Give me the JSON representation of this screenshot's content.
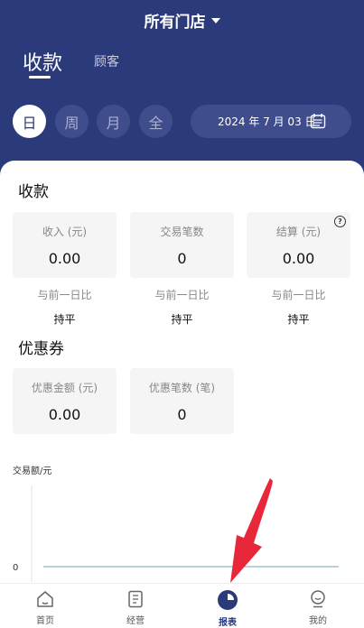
{
  "header": {
    "store_selector": "所有门店"
  },
  "tabs": [
    {
      "label": "收款",
      "active": true
    },
    {
      "label": "顾客",
      "active": false
    }
  ],
  "periods": [
    {
      "label": "日",
      "active": true
    },
    {
      "label": "周"
    },
    {
      "label": "月"
    },
    {
      "label": "全"
    }
  ],
  "date_picker": {
    "value": "2024 年 7 月 03 日"
  },
  "payment_section": {
    "title": "收款",
    "stats": [
      {
        "label": "收入 (元)",
        "value": "0.00",
        "compare_label": "与前一日比",
        "compare_value": "持平"
      },
      {
        "label": "交易笔数",
        "value": "0",
        "compare_label": "与前一日比",
        "compare_value": "持平"
      },
      {
        "label": "结算 (元)",
        "value": "0.00",
        "compare_label": "与前一日比",
        "compare_value": "持平"
      }
    ]
  },
  "coupon_section": {
    "title": "优惠券",
    "stats": [
      {
        "label": "优惠金额 (元)",
        "value": "0.00"
      },
      {
        "label": "优惠笔数 (笔)",
        "value": "0"
      }
    ]
  },
  "chart_data": {
    "type": "line",
    "ylabel": "交易额/元",
    "y_ticks": [
      "0"
    ],
    "series": [
      {
        "values": [
          0,
          0
        ]
      }
    ]
  },
  "bottom_nav": [
    {
      "label": "首页",
      "icon": "home-icon"
    },
    {
      "label": "经营",
      "icon": "ledger-icon"
    },
    {
      "label": "报表",
      "icon": "pie-chart-icon",
      "active": true
    },
    {
      "label": "我的",
      "icon": "profile-icon"
    }
  ],
  "colors": {
    "primary": "#2b3a7b",
    "annotation_arrow": "#e8283a"
  }
}
